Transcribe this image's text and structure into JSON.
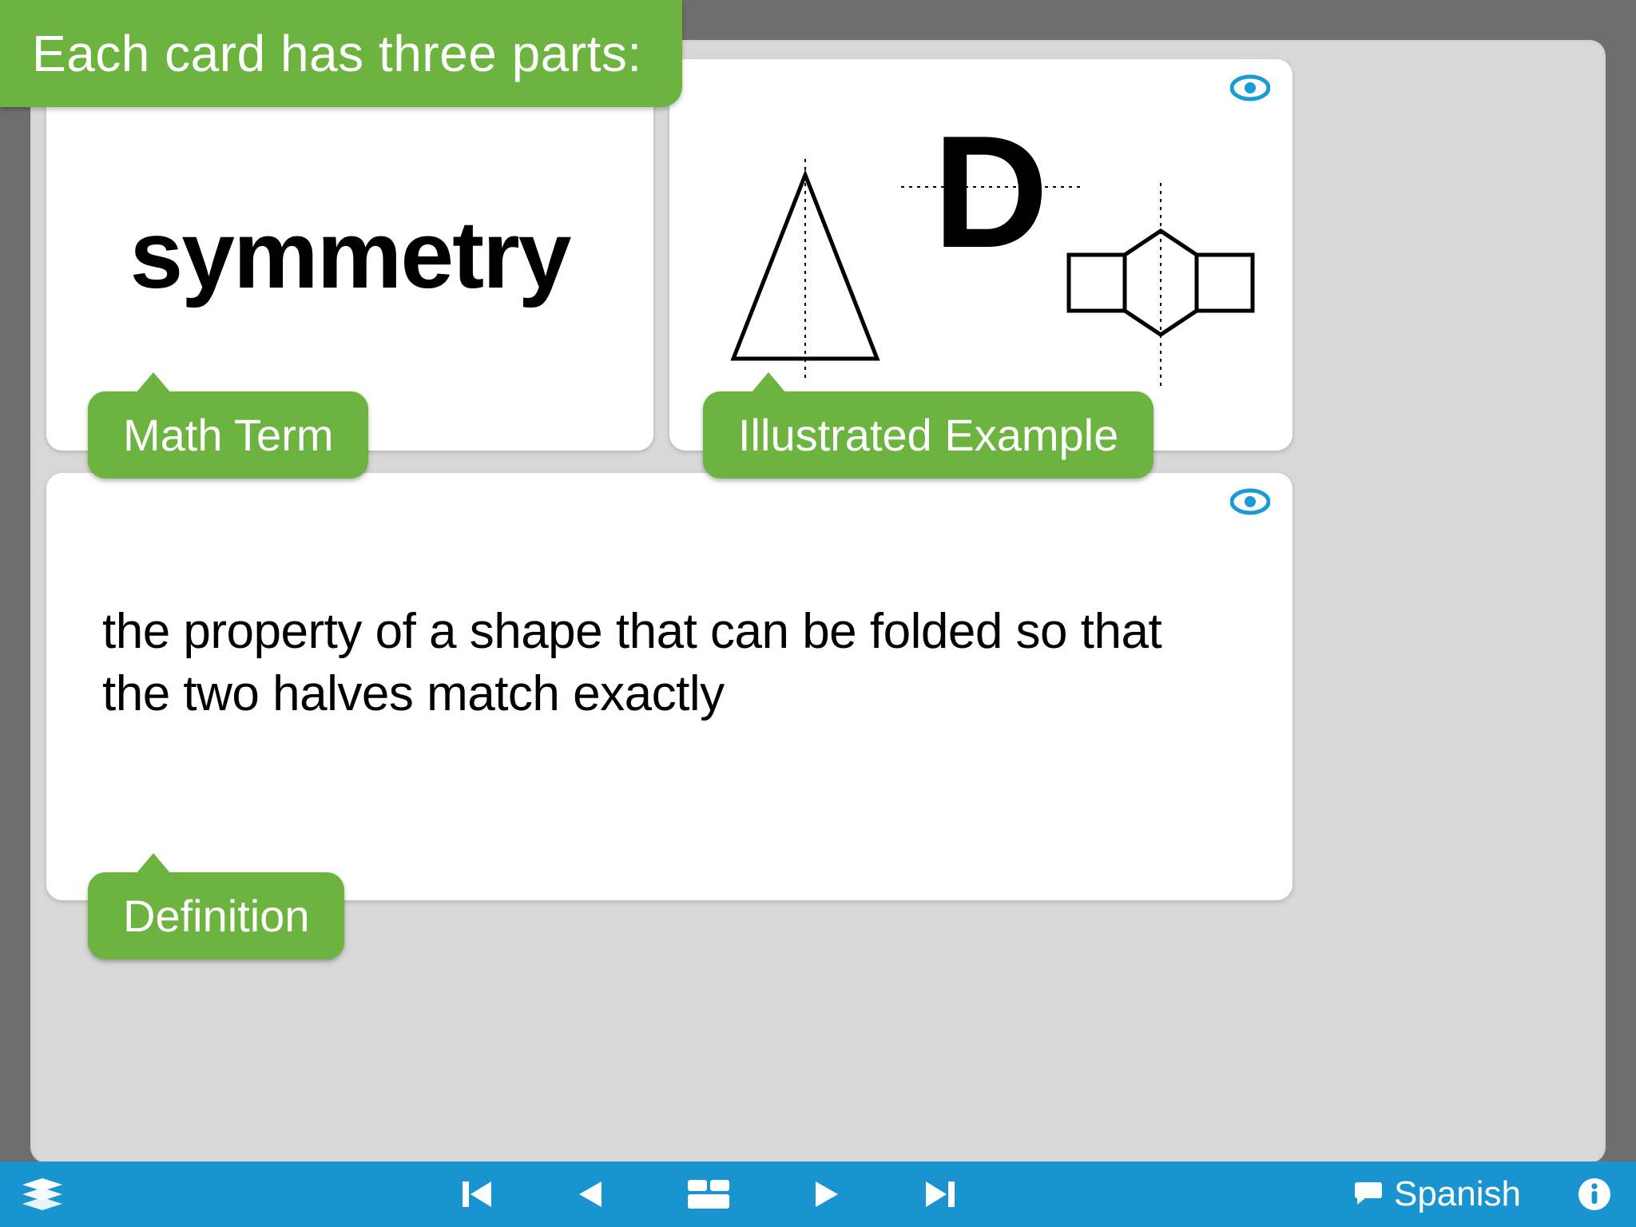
{
  "banner": "Each card has three parts:",
  "term": "symmetry",
  "definition": "the property of a shape that can be folded so that the two halves match exactly",
  "callouts": {
    "term": "Math Term",
    "illustration": "Illustrated Example",
    "definition": "Definition"
  },
  "toolbar": {
    "language": "Spanish"
  },
  "colors": {
    "green": "#6cb33f",
    "blue": "#1a93d1",
    "eye": "#1a9bd7"
  }
}
